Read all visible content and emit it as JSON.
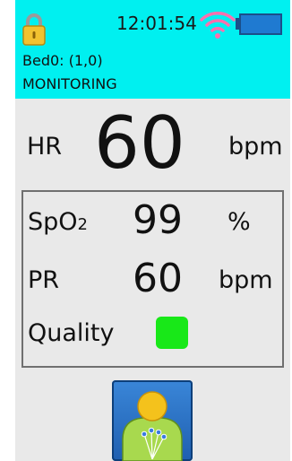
{
  "status_bar": {
    "time": "12:01:54",
    "lock_icon": "padlock-icon",
    "wifi_icon": "wifi-icon",
    "battery_icon": "battery-icon",
    "wifi_color": "#ff6fae",
    "battery_color": "#1f7ad1",
    "header_color": "#00f0f0"
  },
  "bed": {
    "label": "Bed0: (1,0)",
    "mode": "MONITORING"
  },
  "hr": {
    "label": "HR",
    "value": "60",
    "unit": "bpm"
  },
  "spo2": {
    "label_main": "SpO",
    "label_sub": "2",
    "value": "99",
    "unit": "%"
  },
  "pr": {
    "label": "PR",
    "value": "60",
    "unit": "bpm"
  },
  "quality": {
    "label": "Quality",
    "color": "#18e818"
  },
  "patient_button": {
    "icon": "patient-electrodes-icon"
  }
}
